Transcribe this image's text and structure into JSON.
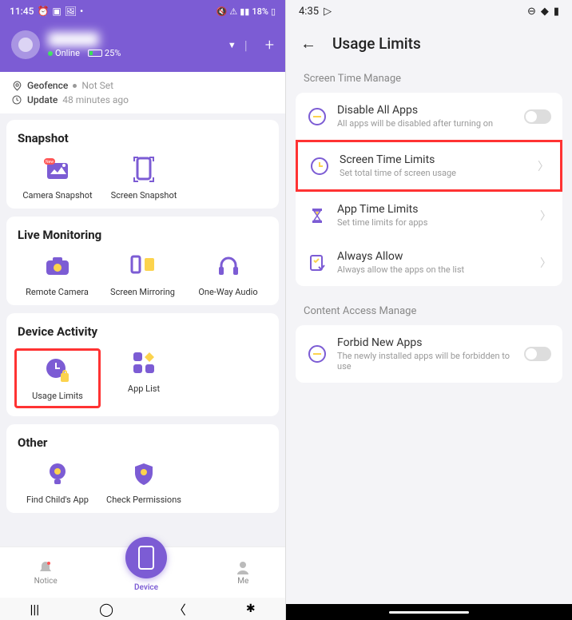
{
  "left": {
    "status": {
      "time": "11:45",
      "battery": "18%",
      "icons": [
        "⏰",
        "📷",
        "🖼",
        "•"
      ]
    },
    "header": {
      "name": "██████",
      "online": "Online",
      "battery_pct": "25%",
      "plus": "+"
    },
    "info": {
      "geofence_label": "Geofence",
      "geofence_value": "Not Set",
      "update_label": "Update",
      "update_value": "48 minutes ago"
    },
    "sections": [
      {
        "title": "Snapshot",
        "items": [
          {
            "label": "Camera Snapshot",
            "icon": "camera-snapshot"
          },
          {
            "label": "Screen Snapshot",
            "icon": "screen-snapshot"
          }
        ]
      },
      {
        "title": "Live Monitoring",
        "items": [
          {
            "label": "Remote Camera",
            "icon": "remote-camera"
          },
          {
            "label": "Screen Mirroring",
            "icon": "screen-mirroring"
          },
          {
            "label": "One-Way Audio",
            "icon": "one-way-audio"
          }
        ]
      },
      {
        "title": "Device Activity",
        "items": [
          {
            "label": "Usage Limits",
            "icon": "usage-limits",
            "highlighted": true
          },
          {
            "label": "App List",
            "icon": "app-list"
          }
        ]
      },
      {
        "title": "Other",
        "items": [
          {
            "label": "Find Child's App",
            "icon": "find-childs-app"
          },
          {
            "label": "Check Permissions",
            "icon": "check-permissions"
          }
        ]
      }
    ],
    "bottom_nav": {
      "notice": "Notice",
      "device": "Device",
      "me": "Me"
    }
  },
  "right": {
    "status": {
      "time": "4:35"
    },
    "title": "Usage Limits",
    "section1_header": "Screen Time Manage",
    "section1": [
      {
        "title": "Disable All Apps",
        "sub": "All apps will be disabled after turning on",
        "control": "toggle"
      },
      {
        "title": "Screen Time Limits",
        "sub": "Set total time of screen usage",
        "control": "chevron",
        "highlighted": true
      },
      {
        "title": "App Time Limits",
        "sub": "Set time limits for apps",
        "control": "chevron"
      },
      {
        "title": "Always Allow",
        "sub": "Always allow the apps on the list",
        "control": "chevron"
      }
    ],
    "section2_header": "Content Access Manage",
    "section2": [
      {
        "title": "Forbid New Apps",
        "sub": "The newly installed apps will be forbidden to use",
        "control": "toggle"
      }
    ]
  },
  "colors": {
    "purple": "#7c5cd4",
    "highlight": "#f33"
  }
}
